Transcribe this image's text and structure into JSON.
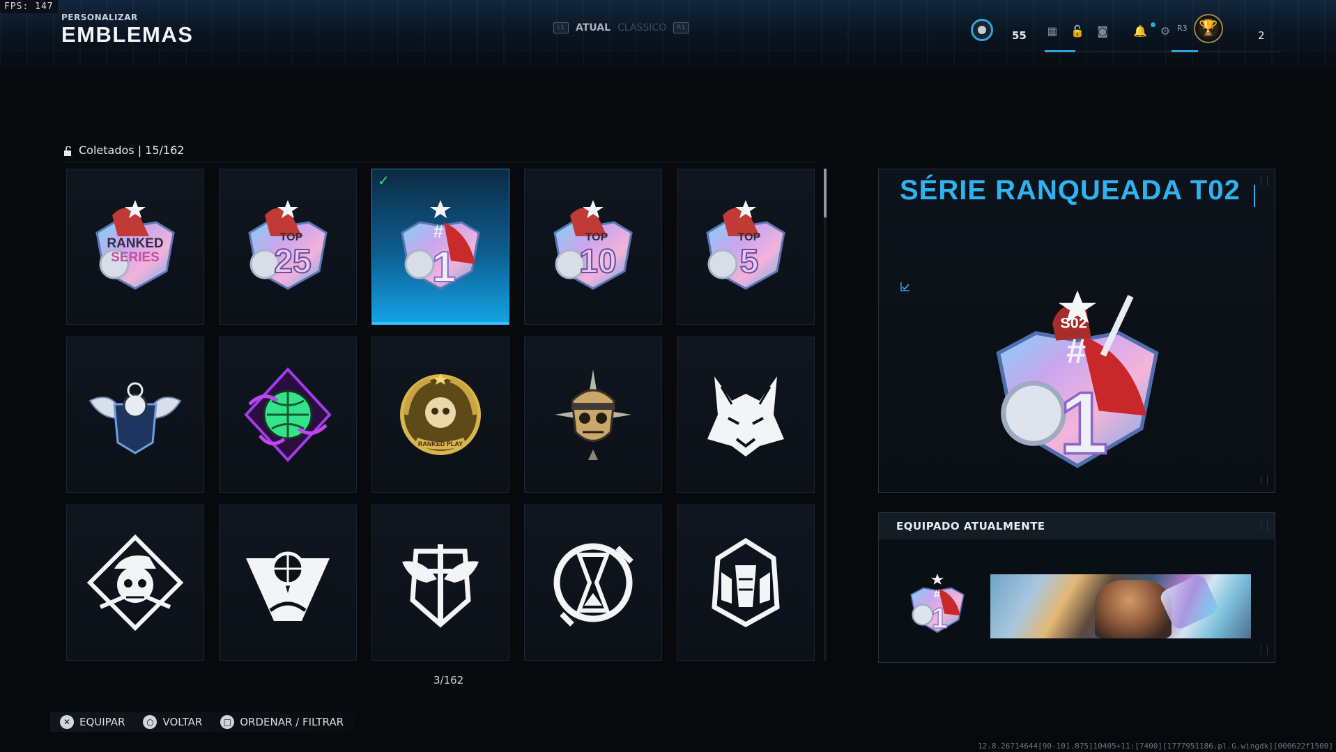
{
  "fps": "FPS: 147",
  "header": {
    "subtitle": "PERSONALIZAR",
    "title": "EMBLEMAS",
    "mode_left_key": "L1",
    "mode_active": "ATUAL",
    "mode_inactive": "CLÁSSICO",
    "mode_right_key": "R1"
  },
  "hud": {
    "coins": "55",
    "r3_label": "R3",
    "count": "2"
  },
  "collection": {
    "label": "Coletados | 15/162",
    "pager": "3/162"
  },
  "emblems": [
    {
      "name": "ranked-series-s02",
      "label": "RANKED SERIES",
      "selected": false
    },
    {
      "name": "top-25-s02",
      "label": "25",
      "selected": false
    },
    {
      "name": "number-1-s02",
      "label": "1",
      "selected": true
    },
    {
      "name": "top-10-s02",
      "label": "10",
      "selected": false
    },
    {
      "name": "top-5-s02",
      "label": "5",
      "selected": false
    },
    {
      "name": "winged-angel",
      "label": "",
      "selected": false
    },
    {
      "name": "green-globe",
      "label": "",
      "selected": false
    },
    {
      "name": "gold-skull-ranked-play",
      "label": "RANKED PLAY",
      "selected": false
    },
    {
      "name": "spiked-skull",
      "label": "",
      "selected": false
    },
    {
      "name": "wolf-head",
      "label": "",
      "selected": false
    },
    {
      "name": "skull-beret",
      "label": "",
      "selected": false
    },
    {
      "name": "globe-v",
      "label": "",
      "selected": false
    },
    {
      "name": "winged-sword-shield",
      "label": "",
      "selected": false
    },
    {
      "name": "hourglass",
      "label": "",
      "selected": false
    },
    {
      "name": "pharaoh-helmet",
      "label": "",
      "selected": false
    }
  ],
  "detail": {
    "title": "SÉRIE RANQUEADA T02"
  },
  "equipped": {
    "header": "EQUIPADO ATUALMENTE"
  },
  "footer": {
    "equip": "EQUIPAR",
    "back": "VOLTAR",
    "sort": "ORDENAR / FILTRAR"
  },
  "build": "12.8.26714644[90-101.875]10405+11:[7400][1777951186.pl.G.wingdk][000622f1500]",
  "colors": {
    "accent": "#2fb3f0",
    "selected_tile": "#14a4e6",
    "check": "#3ee06a"
  }
}
